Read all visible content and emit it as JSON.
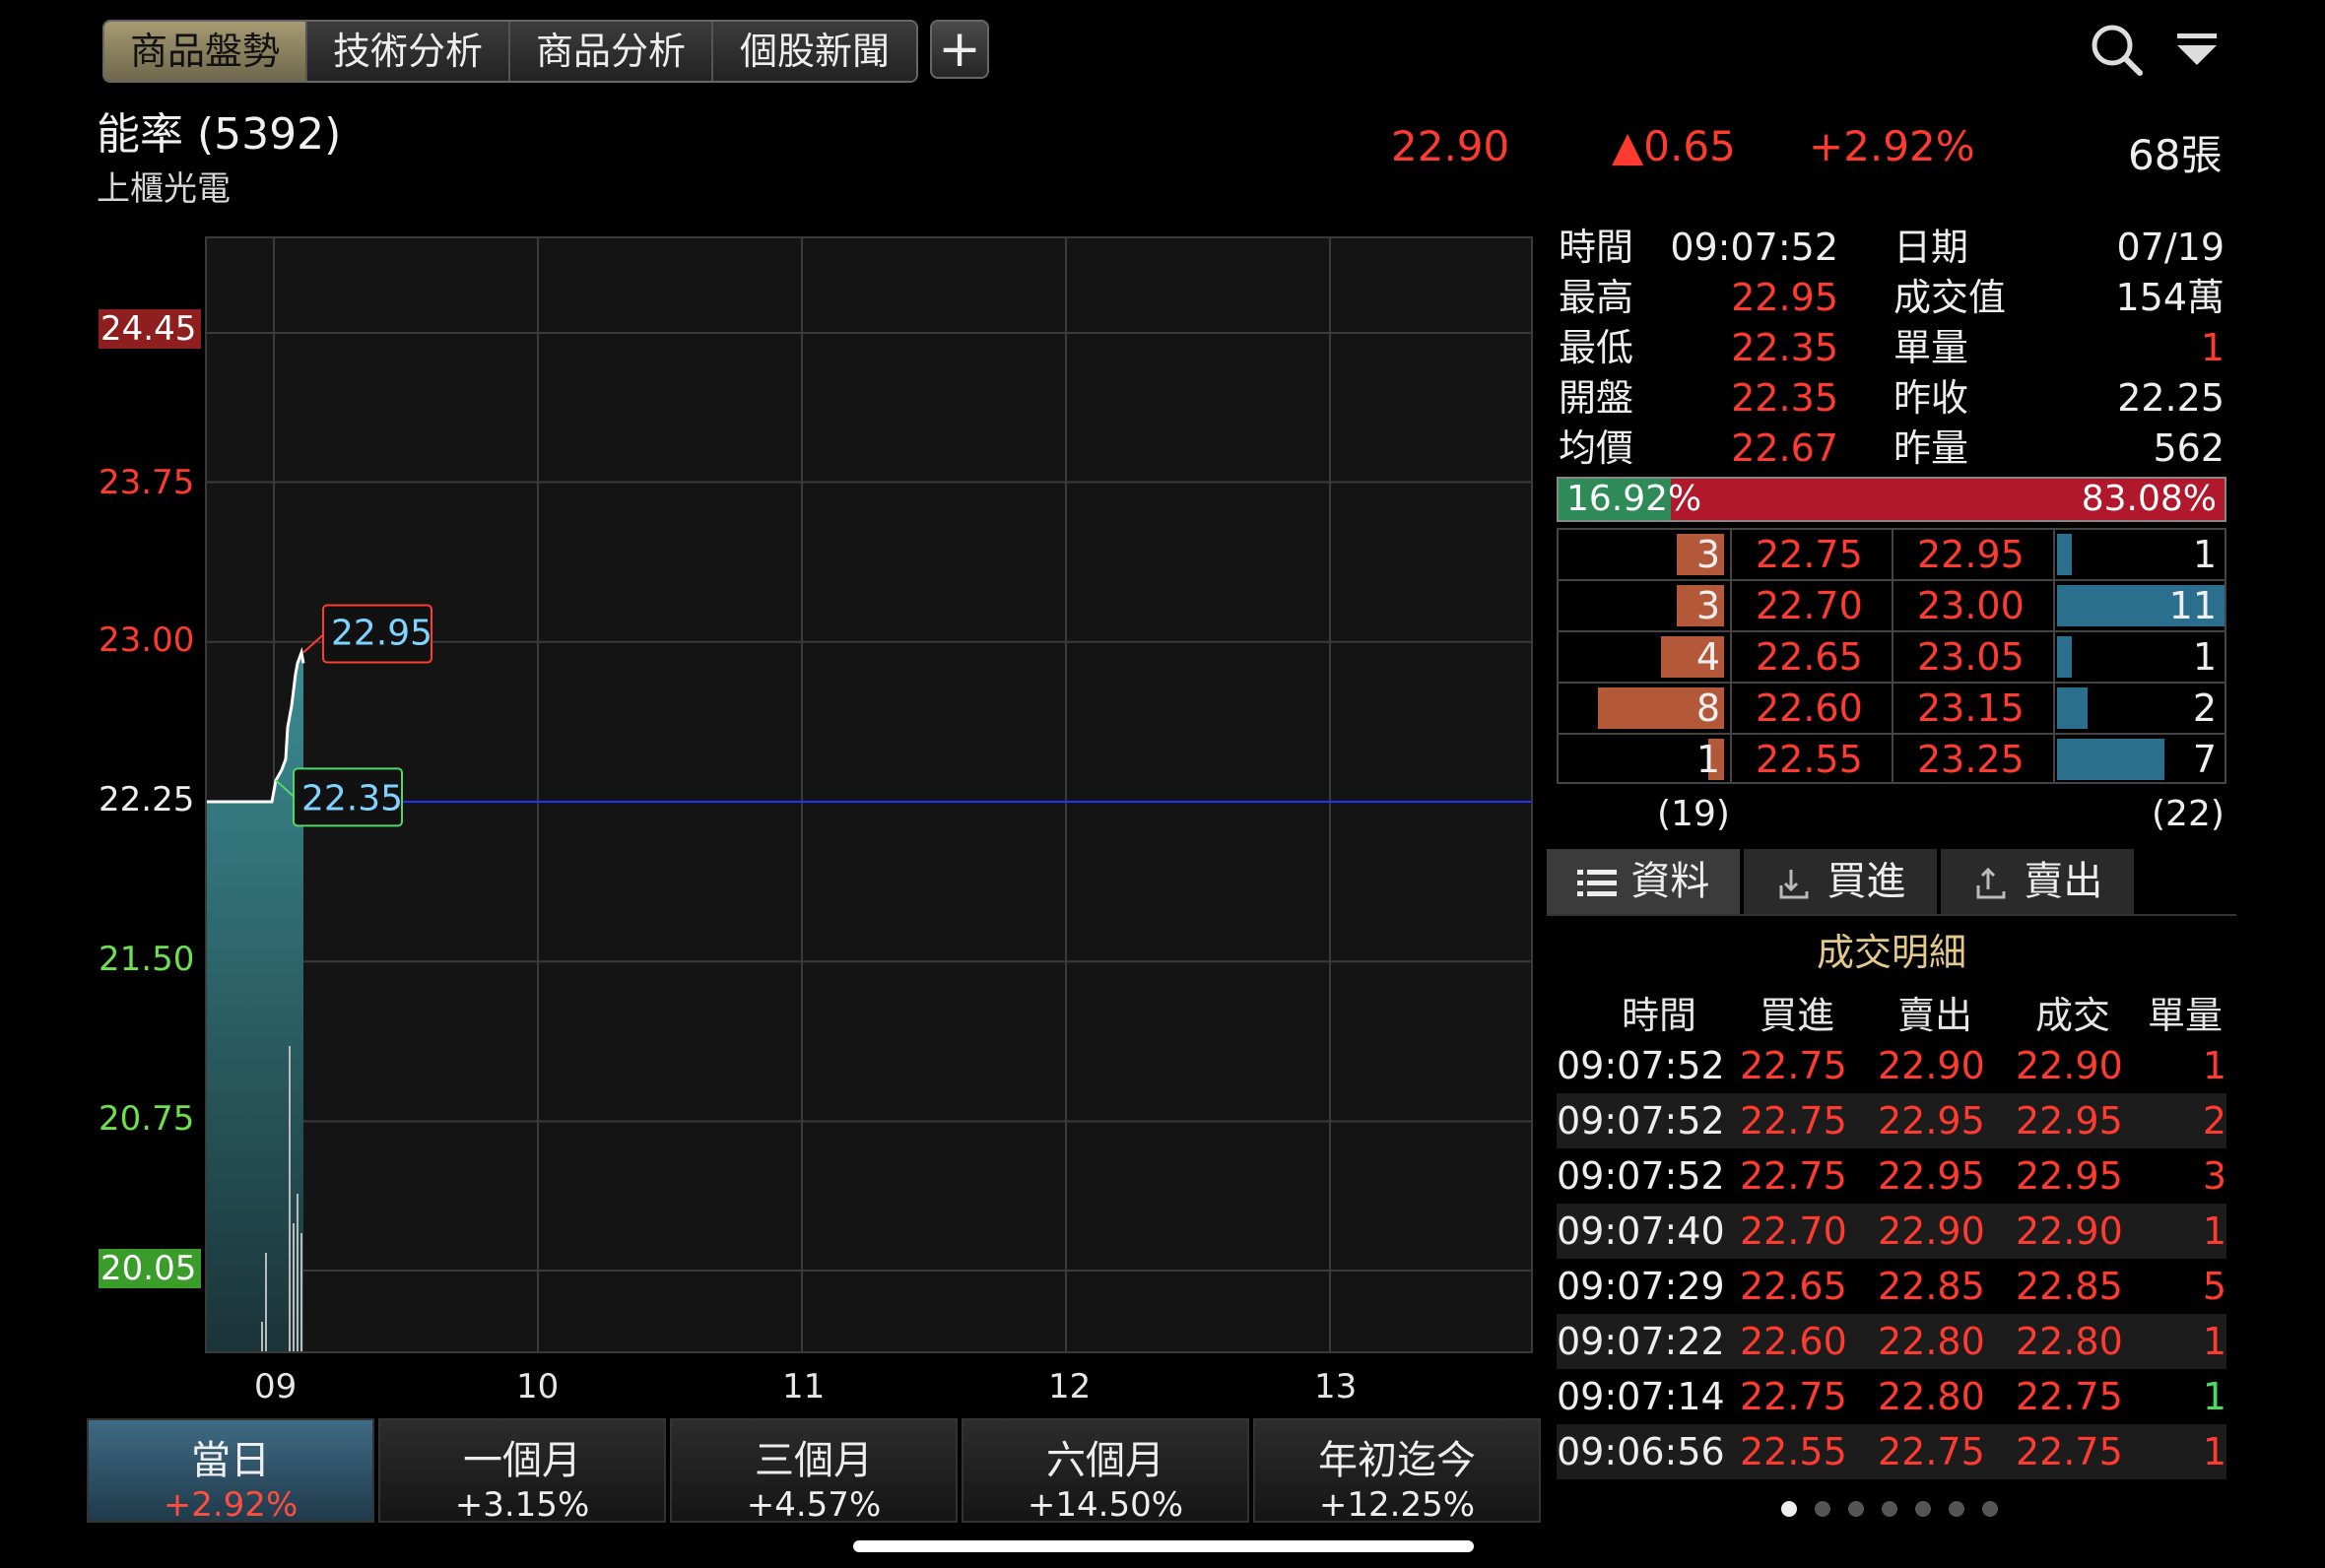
{
  "tabs": [
    "商品盤勢",
    "技術分析",
    "商品分析",
    "個股新聞"
  ],
  "plus_label": "+",
  "stock": {
    "name": "能率 (5392)",
    "market": "上櫃光電"
  },
  "quote": {
    "price": "22.90",
    "change": "▲0.65",
    "change_pct": "+2.92%",
    "volume": "68張"
  },
  "chart": {
    "y_labels": [
      "24.45",
      "23.75",
      "23.00",
      "22.25",
      "21.50",
      "20.75",
      "20.05"
    ],
    "x_labels": [
      "09",
      "10",
      "11",
      "12",
      "13"
    ],
    "high_tag": "22.95",
    "low_tag": "22.35"
  },
  "chart_data": {
    "type": "area",
    "x_labels": [
      "09",
      "10",
      "11",
      "12",
      "13"
    ],
    "ylim": [
      20.05,
      24.45
    ],
    "reference_price": 22.25,
    "high": 22.95,
    "low": 22.35,
    "series": [
      {
        "points": [
          22.25,
          22.25,
          22.25,
          22.25,
          22.35,
          22.4,
          22.45,
          22.6,
          22.7,
          22.85,
          22.9,
          22.95,
          22.9
        ]
      }
    ]
  },
  "info": {
    "rows": [
      {
        "k1": "時間",
        "v1": "09:07:52",
        "k2": "日期",
        "v2": "07/19"
      },
      {
        "k1": "最高",
        "v1": "22.95",
        "k2": "成交值",
        "v2": "154萬"
      },
      {
        "k1": "最低",
        "v1": "22.35",
        "k2": "單量",
        "v2": "1"
      },
      {
        "k1": "開盤",
        "v1": "22.35",
        "k2": "昨收",
        "v2": "22.25"
      },
      {
        "k1": "均價",
        "v1": "22.67",
        "k2": "昨量",
        "v2": "562"
      }
    ]
  },
  "ratio": {
    "buy_pct": "16.92%",
    "sell_pct": "83.08%",
    "buy_fraction": 0.1692
  },
  "order_book": {
    "rows": [
      {
        "bid_qty": "3",
        "bid": "22.75",
        "ask": "22.95",
        "ask_qty": "1",
        "bid_frac": 0.375,
        "ask_frac": 0.09
      },
      {
        "bid_qty": "3",
        "bid": "22.70",
        "ask": "23.00",
        "ask_qty": "11",
        "bid_frac": 0.375,
        "ask_frac": 1.0
      },
      {
        "bid_qty": "4",
        "bid": "22.65",
        "ask": "23.05",
        "ask_qty": "1",
        "bid_frac": 0.5,
        "ask_frac": 0.09
      },
      {
        "bid_qty": "8",
        "bid": "22.60",
        "ask": "23.15",
        "ask_qty": "2",
        "bid_frac": 1.0,
        "ask_frac": 0.18
      },
      {
        "bid_qty": "1",
        "bid": "22.55",
        "ask": "23.25",
        "ask_qty": "7",
        "bid_frac": 0.125,
        "ask_frac": 0.64
      }
    ],
    "bid_total": "(19)",
    "ask_total": "(22)"
  },
  "sub_tabs": [
    "資料",
    "買進",
    "賣出"
  ],
  "trade_title": "成交明細",
  "trade_headers": [
    "時間",
    "買進",
    "賣出",
    "成交",
    "單量"
  ],
  "trades": [
    {
      "t": "09:07:52",
      "b": "22.75",
      "s": "22.90",
      "p": "22.90",
      "q": "1",
      "up": true
    },
    {
      "t": "09:07:52",
      "b": "22.75",
      "s": "22.95",
      "p": "22.95",
      "q": "2",
      "up": true
    },
    {
      "t": "09:07:52",
      "b": "22.75",
      "s": "22.95",
      "p": "22.95",
      "q": "3",
      "up": true
    },
    {
      "t": "09:07:40",
      "b": "22.70",
      "s": "22.90",
      "p": "22.90",
      "q": "1",
      "up": true
    },
    {
      "t": "09:07:29",
      "b": "22.65",
      "s": "22.85",
      "p": "22.85",
      "q": "5",
      "up": true
    },
    {
      "t": "09:07:22",
      "b": "22.60",
      "s": "22.80",
      "p": "22.80",
      "q": "1",
      "up": true
    },
    {
      "t": "09:07:14",
      "b": "22.75",
      "s": "22.80",
      "p": "22.75",
      "q": "1",
      "up": false
    },
    {
      "t": "09:06:56",
      "b": "22.55",
      "s": "22.75",
      "p": "22.75",
      "q": "1",
      "up": true
    }
  ],
  "periods": [
    {
      "label": "當日",
      "pct": "+2.92%"
    },
    {
      "label": "一個月",
      "pct": "+3.15%"
    },
    {
      "label": "三個月",
      "pct": "+4.57%"
    },
    {
      "label": "六個月",
      "pct": "+14.50%"
    },
    {
      "label": "年初迄今",
      "pct": "+12.25%"
    }
  ],
  "icons": [
    "search-icon",
    "filter-icon",
    "list-icon",
    "buy-icon",
    "sell-icon"
  ]
}
